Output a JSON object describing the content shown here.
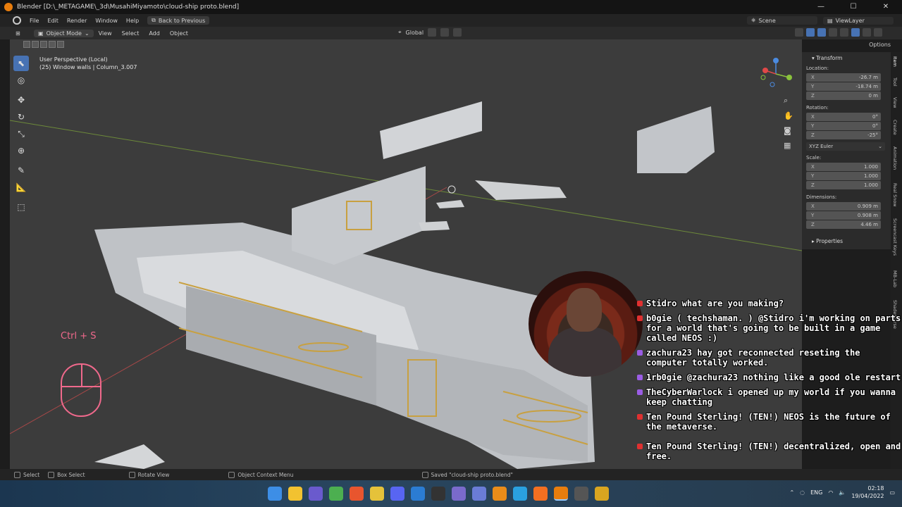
{
  "window": {
    "title": "Blender [D:\\_METAGAME\\_3d\\MusahiMiyamoto\\cloud-ship proto.blend]",
    "controls": [
      "—",
      "☐",
      "✕"
    ]
  },
  "menubar": {
    "items": [
      "File",
      "Edit",
      "Render",
      "Window",
      "Help"
    ],
    "back_label": "Back to Previous",
    "scene_label": "Scene",
    "viewlayer_label": "ViewLayer"
  },
  "viewport_header": {
    "mode": "Object Mode",
    "items": [
      "View",
      "Select",
      "Add",
      "Object"
    ],
    "transform_orientation": "Global",
    "options_label": "Options"
  },
  "viewport": {
    "perspective": "User Perspective (Local)",
    "object_info": "(25) Window walls | Column_3.007"
  },
  "overlay": {
    "keystroke": "Ctrl + S"
  },
  "npanel": {
    "section_transform": "Transform",
    "location_label": "Location:",
    "location": [
      {
        "axis": "X",
        "value": "-26.7 m"
      },
      {
        "axis": "Y",
        "value": "-18.74 m"
      },
      {
        "axis": "Z",
        "value": "0 m"
      }
    ],
    "rotation_label": "Rotation:",
    "rotation": [
      {
        "axis": "X",
        "value": "0°"
      },
      {
        "axis": "Y",
        "value": "0°"
      },
      {
        "axis": "Z",
        "value": "-25°"
      }
    ],
    "rotation_mode": "XYZ Euler",
    "scale_label": "Scale:",
    "scale": [
      {
        "axis": "X",
        "value": "1.000"
      },
      {
        "axis": "Y",
        "value": "1.000"
      },
      {
        "axis": "Z",
        "value": "1.000"
      }
    ],
    "dimensions_label": "Dimensions:",
    "dimensions": [
      {
        "axis": "X",
        "value": "0.909 m"
      },
      {
        "axis": "Y",
        "value": "0.908 m"
      },
      {
        "axis": "Z",
        "value": "4.46 m"
      }
    ],
    "section_properties": "Properties"
  },
  "side_tabs": [
    "Item",
    "Tool",
    "View",
    "Create",
    "Animation",
    "Real Snow",
    "Screencast Keys",
    "MB-Lab",
    "Shaderverse"
  ],
  "chat": [
    {
      "user": "Stidro",
      "text": "what are you making?",
      "badge": "#e03030"
    },
    {
      "user": "b0gie ( techshaman. )",
      "text": "@Stidro i'm working on parts for a world that's going to be built in a game called NEOS :)",
      "badge": "#e03030"
    },
    {
      "user": "zachura23",
      "text": "hay got reconnected reseting the computer totally worked.",
      "badge": "#9b5de5"
    },
    {
      "user": "1rb0gie",
      "text": "@zachura23 nothing like a good ole restart",
      "badge": "#9b5de5"
    },
    {
      "user": "TheCyberWarlock",
      "text": "i opened up my world if you wanna keep chatting",
      "badge": "#9b5de5"
    },
    {
      "user": "Ten Pound Sterling! (TEN!)",
      "text": "NEOS is the future of the metaverse.",
      "badge": "#e03030"
    },
    {
      "user": "Ten Pound Sterling! (TEN!)",
      "text": "decentralized, open and free.",
      "badge": "#e03030"
    }
  ],
  "statusbar": {
    "select": "Select",
    "box_select": "Box Select",
    "rotate_view": "Rotate View",
    "context_menu": "Object Context Menu",
    "saved_message": "Saved \"cloud-ship proto.blend\""
  },
  "taskbar": {
    "language": "ENG",
    "time": "02:18",
    "date": "19/04/2022"
  }
}
